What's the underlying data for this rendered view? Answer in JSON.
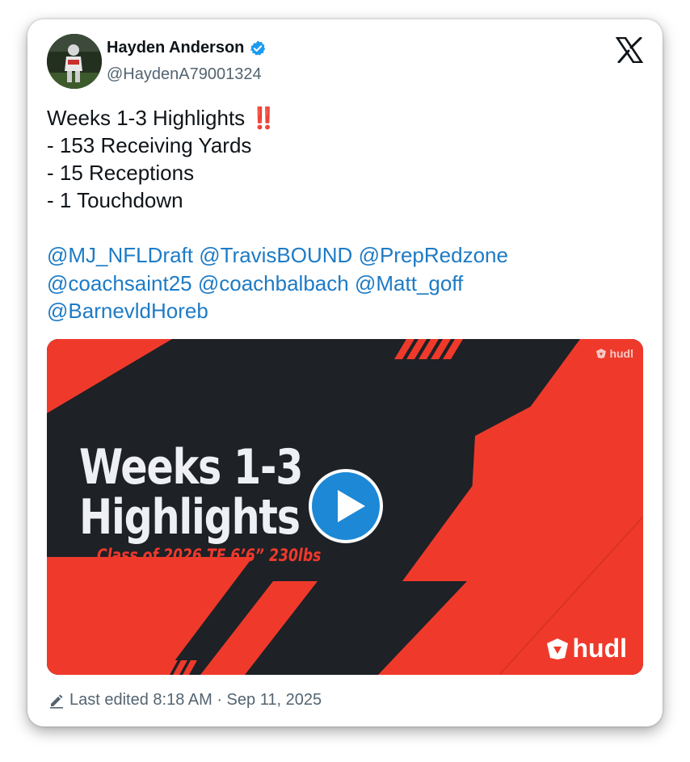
{
  "author": {
    "name": "Hayden Anderson",
    "handle": "@HaydenA79001324",
    "verified": true
  },
  "tweet": {
    "lines": [
      "Weeks 1-3 Highlights",
      "- 153 Receiving Yards",
      "- 15 Receptions",
      "- 1 Touchdown"
    ],
    "emoji": "‼️",
    "mentions": [
      "@MJ_NFLDraft",
      "@TravisBOUND",
      "@PrepRedzone",
      "@coachsaint25",
      "@coachbalbach",
      "@Matt_goff",
      "@BarnevldHoreb"
    ]
  },
  "media": {
    "title_line1": "Weeks 1-3",
    "title_line2": "Highlights",
    "subtitle": "Class of 2026 TE 6’6” 230lbs",
    "brand_small": "hudl",
    "brand_large": "hudl"
  },
  "footer": {
    "edited_text": "Last edited 8:18 AM · Sep 11, 2025"
  },
  "colors": {
    "link": "#1d7bc6",
    "accent_red": "#ef3a2b",
    "dark_bg": "#1e2126",
    "play_blue": "#1d88d6"
  },
  "icons": [
    "verified-badge-icon",
    "x-logo-icon",
    "play-icon",
    "hudl-logo-icon",
    "edit-pencil-icon"
  ]
}
